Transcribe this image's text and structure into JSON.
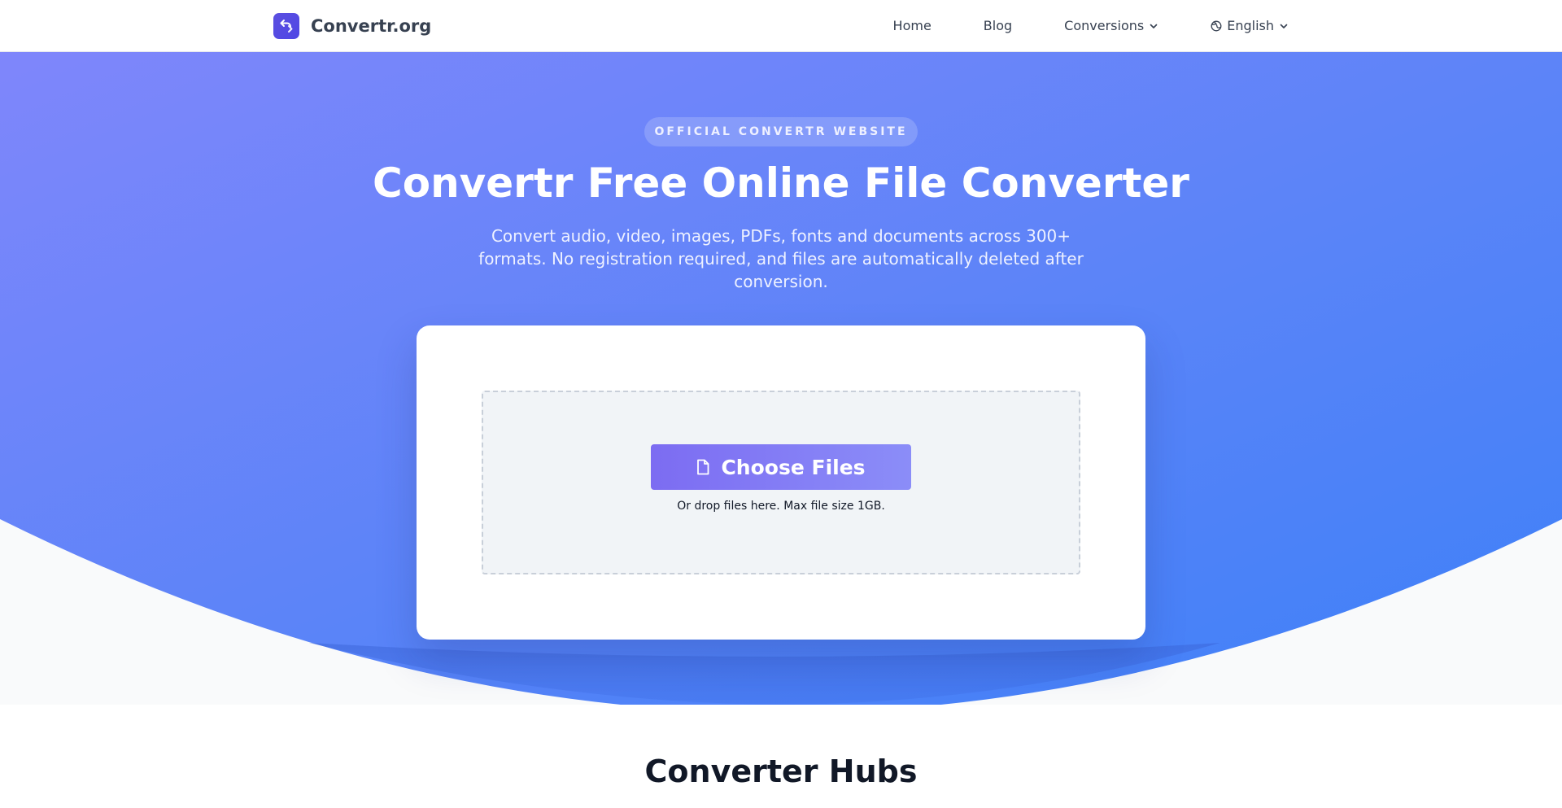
{
  "header": {
    "brand_name": "Convertr.org",
    "brand_icon": "swap-arrows-icon",
    "nav": {
      "home": "Home",
      "blog": "Blog",
      "conversions": "Conversions",
      "language": "English"
    }
  },
  "hero": {
    "badge": "OFFICIAL CONVERTR WEBSITE",
    "title": "Convertr Free Online File Converter",
    "subtitle": "Convert audio, video, images, PDFs, fonts and documents across 300+ formats. No registration required, and files are automatically deleted after conversion."
  },
  "upload": {
    "button_label": "Choose Files",
    "hint": "Or drop files here. Max file size 1GB."
  },
  "hubs": {
    "title": "Converter Hubs"
  },
  "colors": {
    "hero_gradient_start": "#7f86fb",
    "hero_gradient_end": "#3d80f8",
    "brand_accent": "#4f46e5",
    "button_gradient_start": "#7c6cf2",
    "button_gradient_end": "#8b8df8"
  }
}
